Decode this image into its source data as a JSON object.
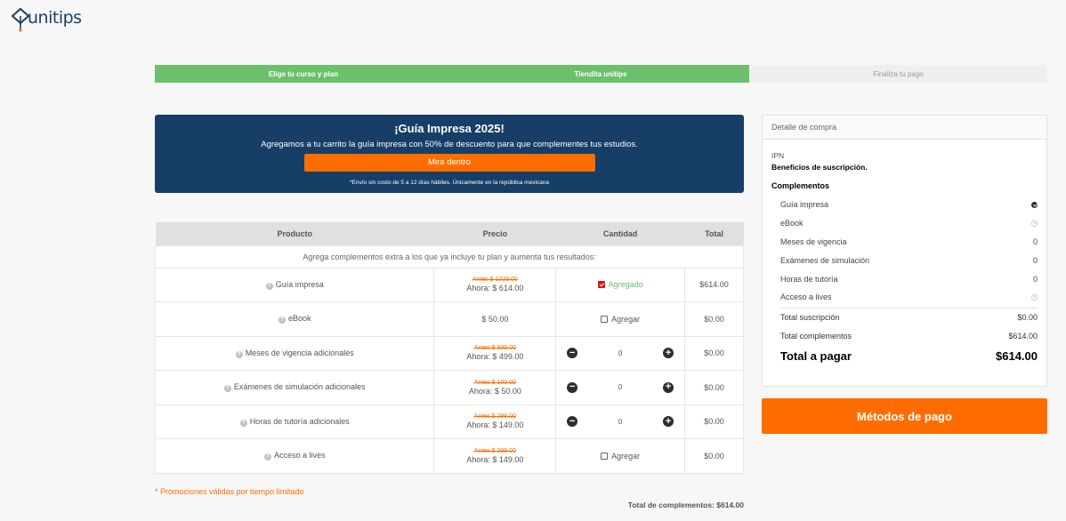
{
  "logo": {
    "text": "unitips"
  },
  "steps": [
    {
      "label": "Elige tu curso y plan"
    },
    {
      "label": "Tiendita unitips"
    },
    {
      "label": "Finaliza tu pago"
    }
  ],
  "banner": {
    "title": "¡Guía Impresa 2025!",
    "text": "Agregamos a tu carrito la guía impresa con 50% de descuento para que complementes tus estudios.",
    "button": "Mira dentro",
    "note": "*Envío sin costo de 5 a 12 días hábiles. Únicamente en la república mexicana"
  },
  "table": {
    "headers": [
      "Producto",
      "Precio",
      "Cantidad",
      "Total"
    ],
    "intro": "Agrega complementos extra a los que ya incluye tu plan y aumenta tus resultados:",
    "rows": [
      {
        "name": "Guía impresa",
        "old": "Antes $ 1229.00",
        "now": "Ahora: $ 614.00",
        "qty_label": "Agregado",
        "total": "$614.00"
      },
      {
        "name": "eBook",
        "price": "$ 50.00",
        "qty_label": "Agregar",
        "total": "$0.00"
      },
      {
        "name": "Meses de vigencia adicionales",
        "old": "Antes $ 999.00",
        "now": "Ahora: $ 499.00",
        "qty": "0",
        "total": "$0.00"
      },
      {
        "name": "Exámenes de simulación adicionales",
        "old": "Antes $ 100.00",
        "now": "Ahora: $ 50.00",
        "qty": "0",
        "total": "$0.00"
      },
      {
        "name": "Horas de tutoría adicionales",
        "old": "Antes $ 298.00",
        "now": "Ahora: $ 149.00",
        "qty": "0",
        "total": "$0.00"
      },
      {
        "name": "Acceso a lives",
        "old": "Antes $ 299.00",
        "now": "Ahora: $ 149.00",
        "qty_label": "Agregar",
        "total": "$0.00"
      }
    ]
  },
  "promo_note": "* Promociones válidas por tiempo limitado",
  "total_complements_line": "Total de complementos: $614.00",
  "summary": {
    "header": "Detalle de compra",
    "institution": "IPN",
    "benefits": "Beneficios de suscripción.",
    "complements_title": "Complementos",
    "items": [
      {
        "label": "Guía impresa"
      },
      {
        "label": "eBook"
      },
      {
        "label": "Meses de vigencia",
        "value": "0"
      },
      {
        "label": "Exámenes de simulación",
        "value": "0"
      },
      {
        "label": "Horas de tutoría",
        "value": "0"
      },
      {
        "label": "Acceso a lives"
      }
    ],
    "subscription_label": "Total suscripción",
    "subscription_value": "$0.00",
    "complements_label": "Total complementos",
    "complements_value": "$614.00",
    "grand_label": "Total a pagar",
    "grand_value": "$614.00"
  },
  "pay_button": "Métodos de pago"
}
